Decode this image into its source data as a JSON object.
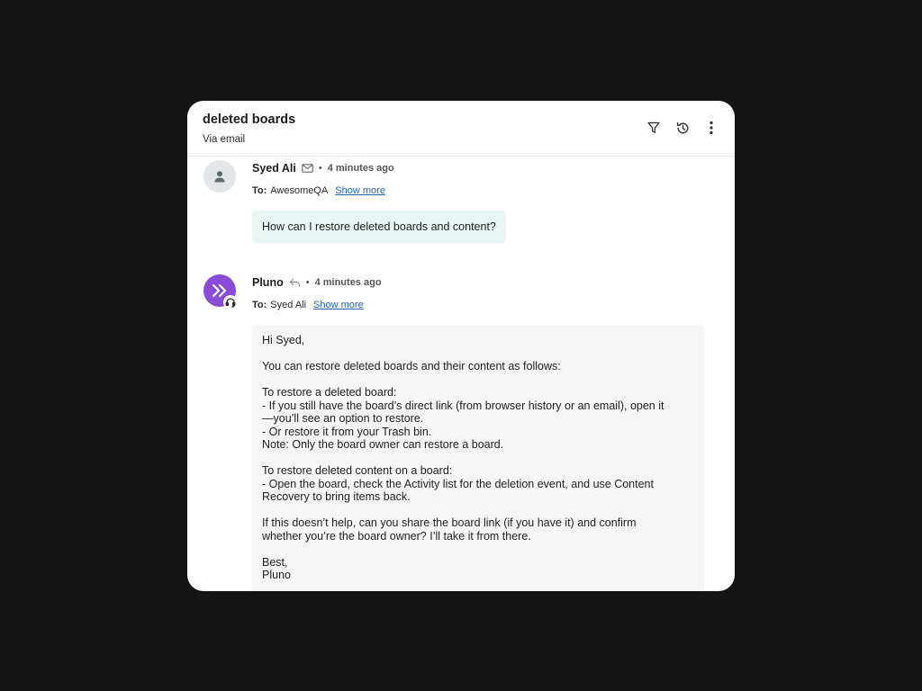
{
  "header": {
    "title": "deleted boards",
    "subtitle": "Via email",
    "icons": [
      "filter-icon",
      "history-icon",
      "more-vertical-icon"
    ]
  },
  "messages": [
    {
      "sender": "Syed Ali",
      "channel_icon": "envelope-icon",
      "time": "4 minutes ago",
      "to_label": "To:",
      "to_value": "AwesomeQA",
      "show_more": "Show more",
      "body": "How can I restore deleted boards and content?"
    },
    {
      "sender": "Pluno",
      "channel_icon": "reply-icon",
      "time": "4 minutes ago",
      "to_label": "To:",
      "to_value": "Syed Ali",
      "show_more": "Show more",
      "body_lines": [
        "Hi Syed,",
        "",
        "You can restore deleted boards and their content as follows:",
        "",
        "To restore a deleted board:",
        "- If you still have the board’s direct link (from browser history or an email), open it",
        "—you’ll see an option to restore.",
        "- Or restore it from your Trash bin.",
        "Note: Only the board owner can restore a board.",
        "",
        "To restore deleted content on a board:",
        "- Open the board, check the Activity list for the deletion event, and use Content",
        "Recovery to bring items back.",
        "",
        "If this doesn’t help, can you share the board link (if you have it) and confirm",
        "whether you’re the board owner? I’ll take it from there.",
        "",
        "Best,",
        "Pluno"
      ]
    }
  ],
  "colors": {
    "background": "#141414",
    "bot_avatar": "#8a4bd6",
    "user_bubble": "#eaf6f6",
    "bot_bubble": "#f5f6f6",
    "link": "#2563b8"
  }
}
